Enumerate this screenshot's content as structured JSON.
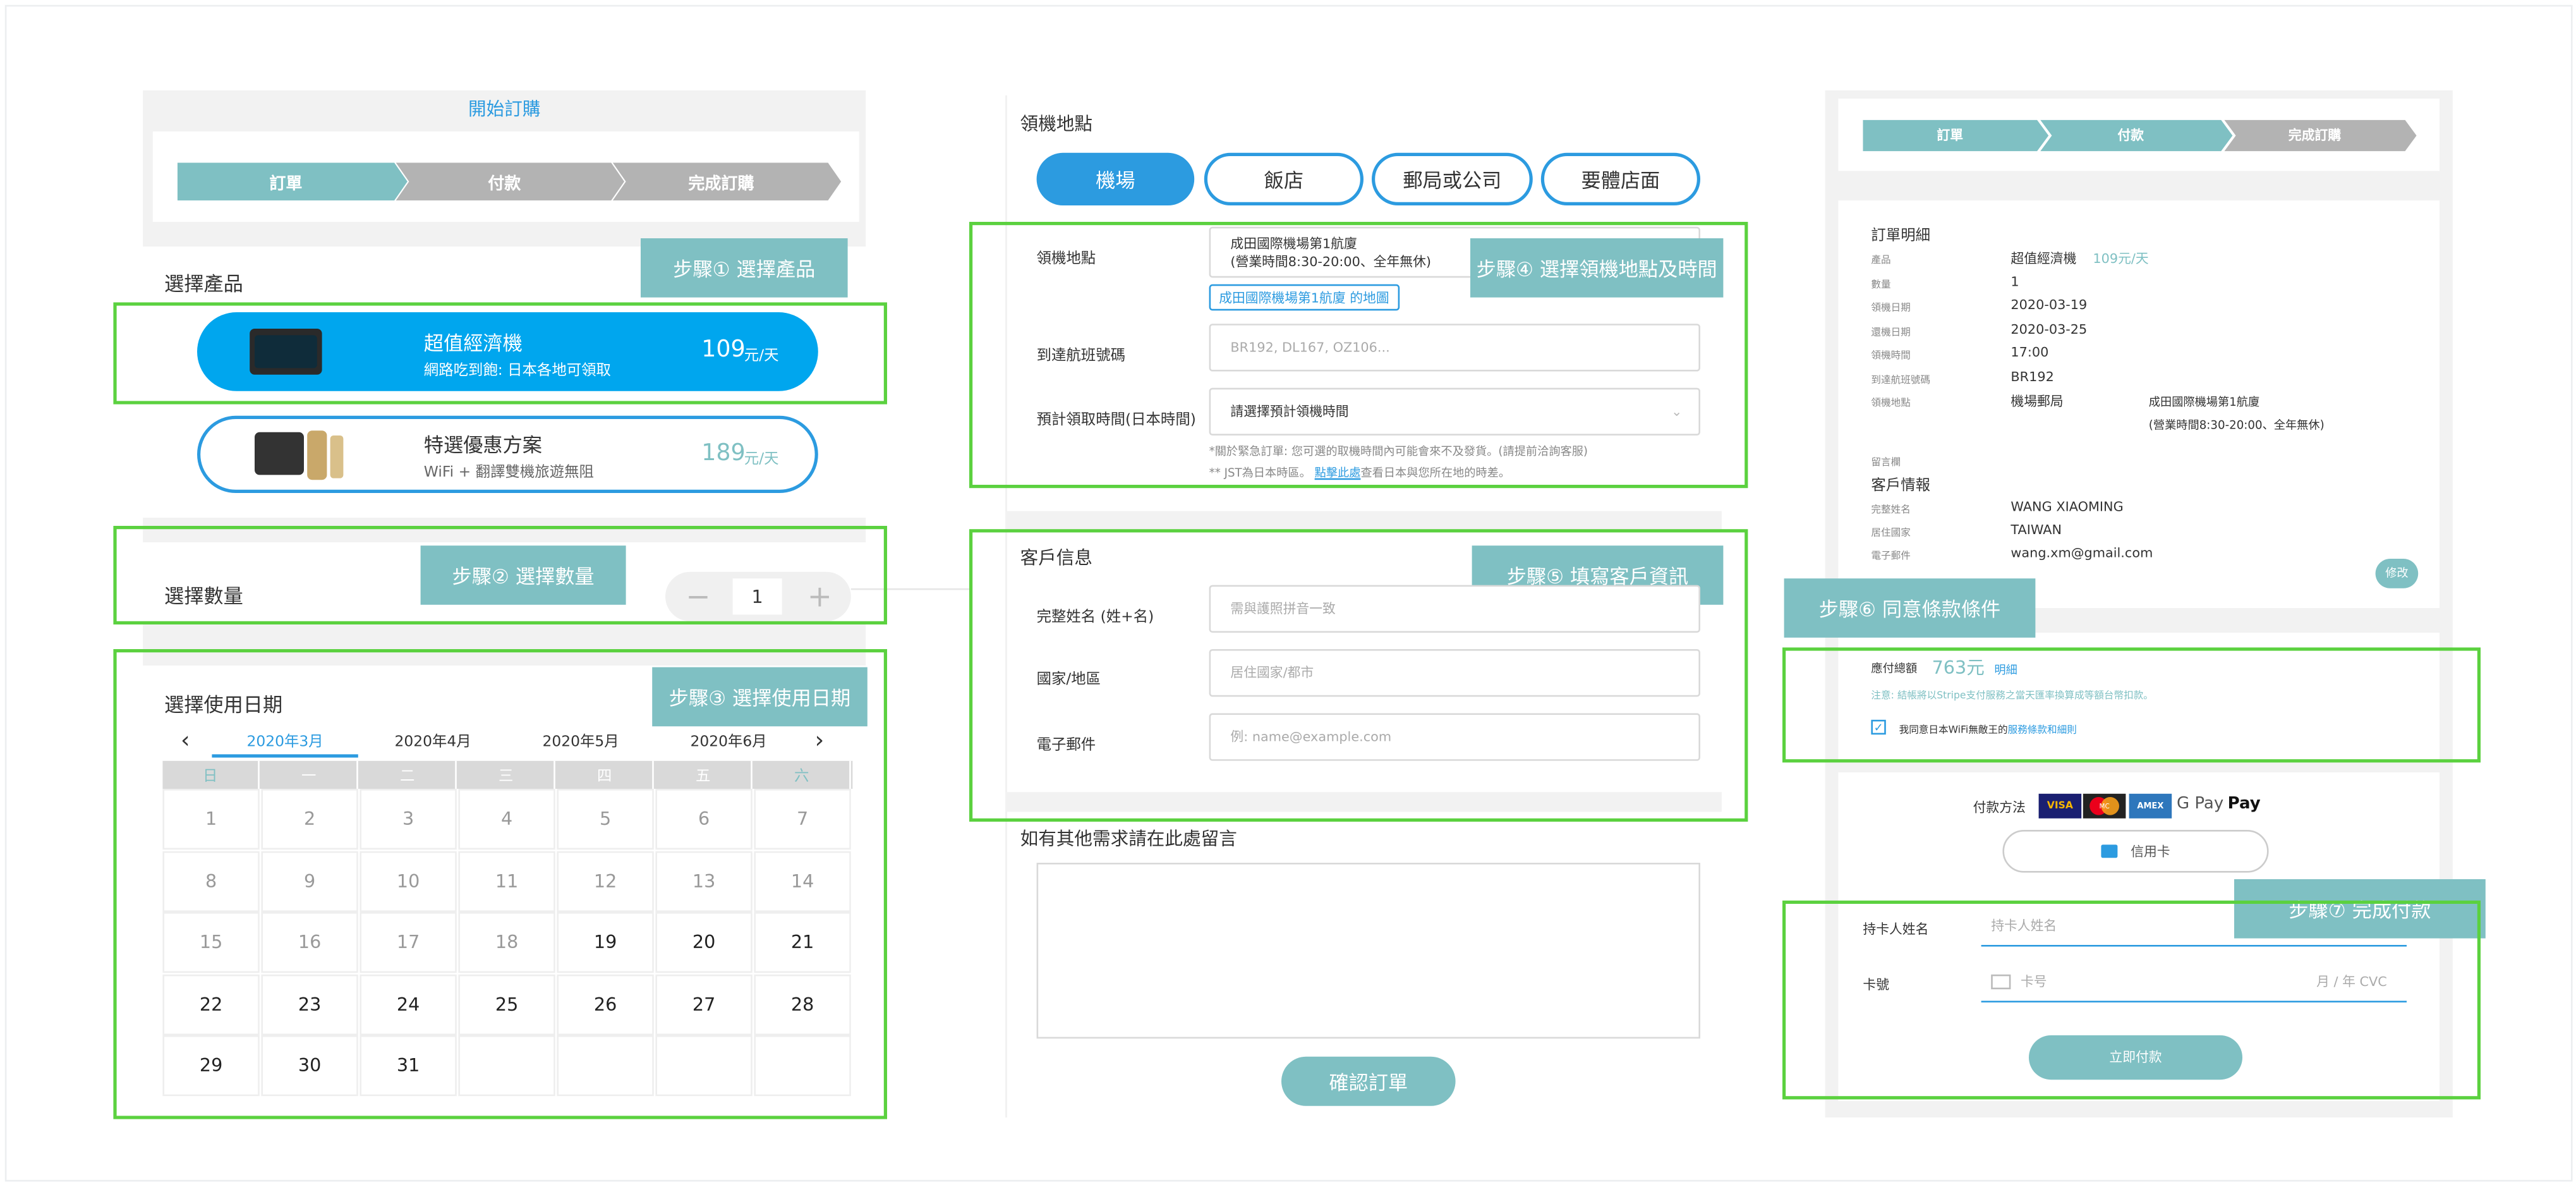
{
  "colors": {
    "teal": "#7fc0c3",
    "blue": "#2c9be0",
    "green": "#5bd13f",
    "grey": "#b3b3b3"
  },
  "left": {
    "start_order": "開始訂購",
    "progress": [
      "訂單",
      "付款",
      "完成訂購"
    ],
    "select_product_label": "選擇產品",
    "step1": "步驟① 選擇產品",
    "product1": {
      "name": "超值經濟機",
      "sub": "網路吃到飽: 日本各地可領取",
      "price": "109",
      "unit": "元/天"
    },
    "product2": {
      "name": "特選優惠方案",
      "sub": "WiFi + 翻譯雙機旅遊無阻",
      "price": "189",
      "unit": "元/天"
    },
    "quantity_label": "選擇數量",
    "step2": "步驟② 選擇數量",
    "qty_minus": "−",
    "qty_value": "1",
    "qty_plus": "+",
    "date_label": "選擇使用日期",
    "step3": "步驟③ 選擇使用日期",
    "months": [
      "2020年3月",
      "2020年4月",
      "2020年5月",
      "2020年6月"
    ],
    "prev": "‹",
    "next": "›",
    "weekdays": [
      "日",
      "一",
      "二",
      "三",
      "四",
      "五",
      "六"
    ],
    "days": [
      "1",
      "2",
      "3",
      "4",
      "5",
      "6",
      "7",
      "8",
      "9",
      "10",
      "11",
      "12",
      "13",
      "14",
      "15",
      "16",
      "17",
      "18",
      "19",
      "20",
      "21",
      "22",
      "23",
      "24",
      "25",
      "26",
      "27",
      "28",
      "29",
      "30",
      "31"
    ]
  },
  "mid": {
    "pickup_title": "領機地點",
    "tabs": [
      "機場",
      "飯店",
      "郵局或公司",
      "要體店面"
    ],
    "pickup_label": "領機地點",
    "pickup_value_line1": "成田國際機場第1航廈",
    "pickup_value_line2": "(營業時間8:30-20:00、全年無休)",
    "map_link": "成田國際機場第1航廈 的地圖",
    "step4": "步驟④ 選擇領機地點及時間",
    "flight_label": "到達航班號碼",
    "flight_placeholder": "BR192, DL167, OZ106...",
    "time_label": "預計領取時間(日本時間)",
    "time_value": "請選擇預計領機時間",
    "note1": "*關於緊急訂單: 您可選的取機時間內可能會來不及發貨。(請提前洽詢客服)",
    "note2_a": "** JST為日本時區。",
    "note2_link": "點擊此處",
    "note2_b": "查看日本與您所在地的時差。",
    "customer_title": "客戶信息",
    "step5": "步驟⑤ 填寫客戶資訊",
    "name_label": "完整姓名 (姓+名)",
    "name_placeholder": "需與護照拼音一致",
    "country_label": "國家/地區",
    "country_placeholder": "居住國家/都市",
    "email_label": "電子郵件",
    "email_placeholder": "例: name@example.com",
    "comment_label": "如有其他需求請在此處留言",
    "confirm": "確認訂單"
  },
  "right": {
    "progress": [
      "訂單",
      "付款",
      "完成訂購"
    ],
    "detail_title": "訂單明細",
    "rows": [
      {
        "k": "產品",
        "v": "超值經濟機",
        "v2": "109元/天"
      },
      {
        "k": "數量",
        "v": "1"
      },
      {
        "k": "領機日期",
        "v": "2020-03-19"
      },
      {
        "k": "還機日期",
        "v": "2020-03-25"
      },
      {
        "k": "領機時間",
        "v": "17:00"
      },
      {
        "k": "到達航班號碼",
        "v": "BR192"
      },
      {
        "k": "領機地點",
        "v": "機場郵局"
      }
    ],
    "place_extra1": "成田國際機場第1航廈",
    "place_extra2": "(營業時間8:30-20:00、全年無休)",
    "message_label": "留言欄",
    "customer_title": "客戶情報",
    "customer_rows": [
      {
        "k": "完整姓名",
        "v": "WANG XIAOMING"
      },
      {
        "k": "居住國家",
        "v": "TAIWAN"
      },
      {
        "k": "電子郵件",
        "v": "wang.xm@gmail.com"
      }
    ],
    "edit": "修改",
    "step6": "步驟⑥ 同意條款條件",
    "total_label": "應付總額",
    "total_value": "763元",
    "detail_link": "明細",
    "note": "注意: 結帳將以Stripe支付服務之當天匯率換算成等額台幣扣款。",
    "agree_prefix": "我同意日本WiFi無敵王的",
    "agree_link": "服務條款和細則",
    "pay_method": "付款方法",
    "pay_brands": [
      "VISA",
      "MC",
      "AMEX"
    ],
    "gpay": "G Pay",
    "apay": " Pay",
    "credit_card": "信用卡",
    "step7": "步驟⑦ 完成付款",
    "holder_label": "持卡人姓名",
    "holder_placeholder": "持卡人姓名",
    "card_label": "卡號",
    "card_placeholder": "卡号",
    "card_exp": "月 / 年  CVC",
    "pay_now": "立即付款"
  }
}
